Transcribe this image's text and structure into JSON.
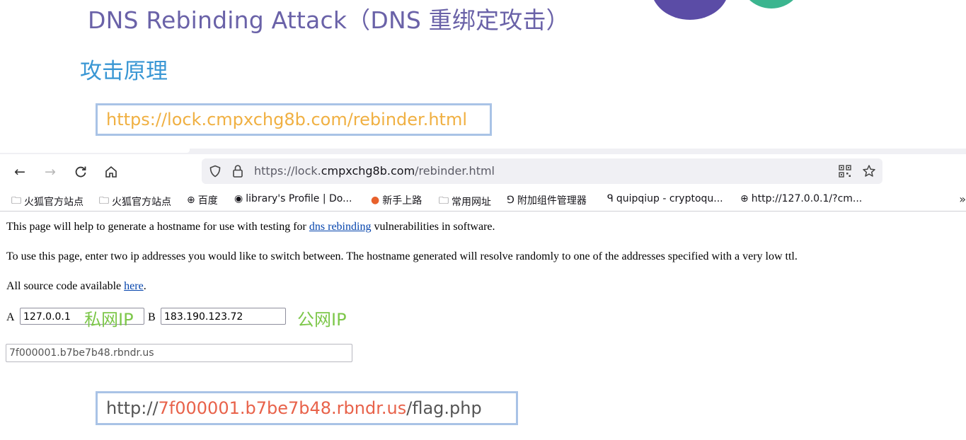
{
  "slide": {
    "title": "DNS Rebinding Attack（DNS 重绑定攻击）",
    "section_heading": "攻击原理",
    "top_url": "https://lock.cmpxchg8b.com/rebinder.html",
    "bottom_url_prefix": "http://",
    "bottom_url_host": "7f000001.b7be7b48.rbndr.us",
    "bottom_url_suffix": "/flag.php",
    "colors": {
      "title": "#6a62a8",
      "heading": "#3a97d4",
      "top_url": "#f0b042",
      "host": "#e8624a",
      "annotation": "#7dc74a"
    }
  },
  "browser": {
    "url_prefix": "https://lock.",
    "url_domain": "cmpxchg8b.com",
    "url_path": "/rebinder.html",
    "nav": {
      "back_icon": "←",
      "forward_icon": "→",
      "reload_icon": "C",
      "home_icon": "⌂"
    },
    "bookmarks": [
      {
        "icon": "folder-icon",
        "glyph": "🗀",
        "label": "火狐官方站点"
      },
      {
        "icon": "folder-icon",
        "glyph": "🗀",
        "label": "火狐官方站点"
      },
      {
        "icon": "globe-icon",
        "glyph": "⊕",
        "label": "百度"
      },
      {
        "icon": "site-icon",
        "glyph": "◉",
        "label": "library's Profile | Do..."
      },
      {
        "icon": "firefox-icon",
        "glyph": "●",
        "label": "新手上路"
      },
      {
        "icon": "folder-icon",
        "glyph": "🗀",
        "label": "常用网址"
      },
      {
        "icon": "puzzle-icon",
        "glyph": "⅁",
        "label": "附加组件管理器"
      },
      {
        "icon": "q-icon",
        "glyph": "ᑫ",
        "label": "quipqiup - cryptoqu..."
      },
      {
        "icon": "globe-icon",
        "glyph": "⊕",
        "label": "http://127.0.0.1/?cm..."
      }
    ],
    "bookmarks_more": "»"
  },
  "page": {
    "intro_before": "This page will help to generate a hostname for use with testing for ",
    "intro_link": "dns rebinding",
    "intro_after": " vulnerabilities in software.",
    "usage": "To use this page, enter two ip addresses you would like to switch between. The hostname generated will resolve randomly to one of the addresses specified with a very low ttl.",
    "source_before": "All source code available ",
    "source_link": "here",
    "source_after": ".",
    "label_a": "A",
    "value_a": "127.0.0.1",
    "annotation_a": "私网IP",
    "label_b": "B",
    "value_b": "183.190.123.72",
    "annotation_b": "公网IP",
    "hostname": "7f000001.b7be7b48.rbndr.us"
  }
}
